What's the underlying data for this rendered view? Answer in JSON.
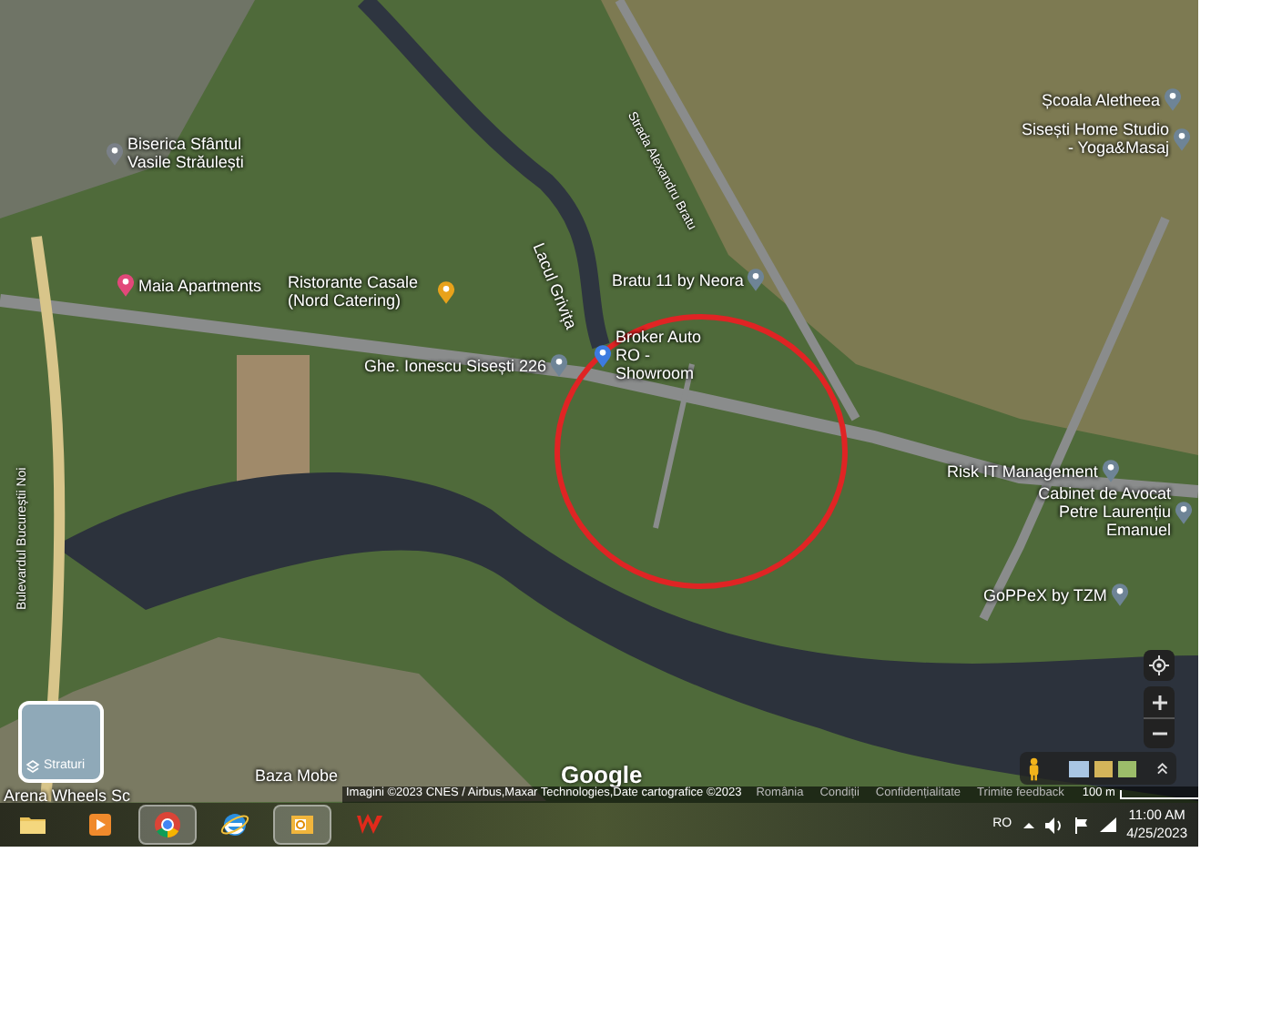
{
  "map": {
    "labels": [
      {
        "text": "Biserica Sfântul Vasile Străulești",
        "kind": "church"
      },
      {
        "text": "Maia Apartments",
        "kind": "hotel"
      },
      {
        "text": "Ristorante Casale (Nord Catering)",
        "kind": "restaurant"
      },
      {
        "text": "Lacul Grivița",
        "kind": "water"
      },
      {
        "text": "Ghe. Ionescu Sisești 226",
        "kind": "place"
      },
      {
        "text": "Bratu 11 by Neora",
        "kind": "place"
      },
      {
        "text": "Broker Auto RO - Showroom",
        "kind": "store"
      },
      {
        "text": "Școala Aletheea",
        "kind": "place"
      },
      {
        "text": "Sisești Home Studio - Yoga&Masaj",
        "kind": "place"
      },
      {
        "text": "Strada Alexandru Bratu",
        "kind": "road"
      },
      {
        "text": "Risk IT Management",
        "kind": "place"
      },
      {
        "text": "Cabinet de Avocat Petre Laurențiu Emanuel",
        "kind": "place"
      },
      {
        "text": "GoPPeX by TZM",
        "kind": "place"
      },
      {
        "text": "Bulevardul Bucureștii Noi",
        "kind": "road"
      },
      {
        "text": "Arena Wheels Sc",
        "kind": "plain"
      },
      {
        "text": "Baza Mobe",
        "kind": "plain"
      }
    ],
    "layers_button": "Straturi",
    "logo": "Google",
    "attribution": "Imagini ©2023 CNES / Airbus,Maxar Technologies,Date cartografice ©2023",
    "footer_links": [
      "România",
      "Condiții",
      "Confidențialitate",
      "Trimite feedback"
    ],
    "scale": "100 m"
  },
  "taskbar": {
    "apps": [
      {
        "kind": "folder",
        "active": false
      },
      {
        "kind": "media",
        "active": false
      },
      {
        "kind": "chrome",
        "active": true
      },
      {
        "kind": "ie",
        "active": false
      },
      {
        "kind": "mail",
        "active": true
      },
      {
        "kind": "w",
        "active": false
      }
    ],
    "language": "RO",
    "time": "11:00 AM",
    "date": "4/25/2023"
  }
}
